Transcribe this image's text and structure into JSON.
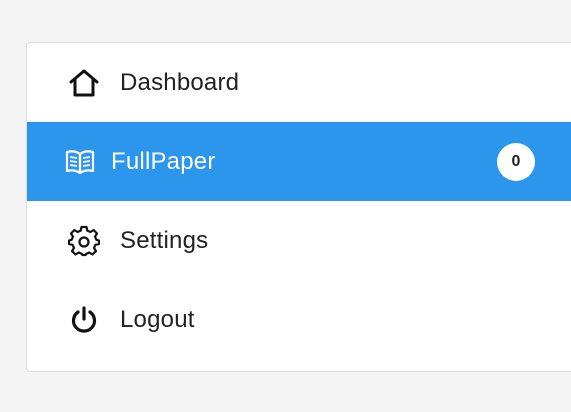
{
  "nav": {
    "items": [
      {
        "label": "Dashboard",
        "icon": "home-icon"
      },
      {
        "label": "FullPaper",
        "icon": "book-open-icon",
        "badge": "0",
        "active": true
      },
      {
        "label": "Settings",
        "icon": "gear-icon"
      },
      {
        "label": "Logout",
        "icon": "power-icon"
      }
    ]
  },
  "colors": {
    "active_background": "#2b96ec",
    "page_background": "#f3f3f3",
    "card_background": "#ffffff",
    "text": "#222222"
  }
}
